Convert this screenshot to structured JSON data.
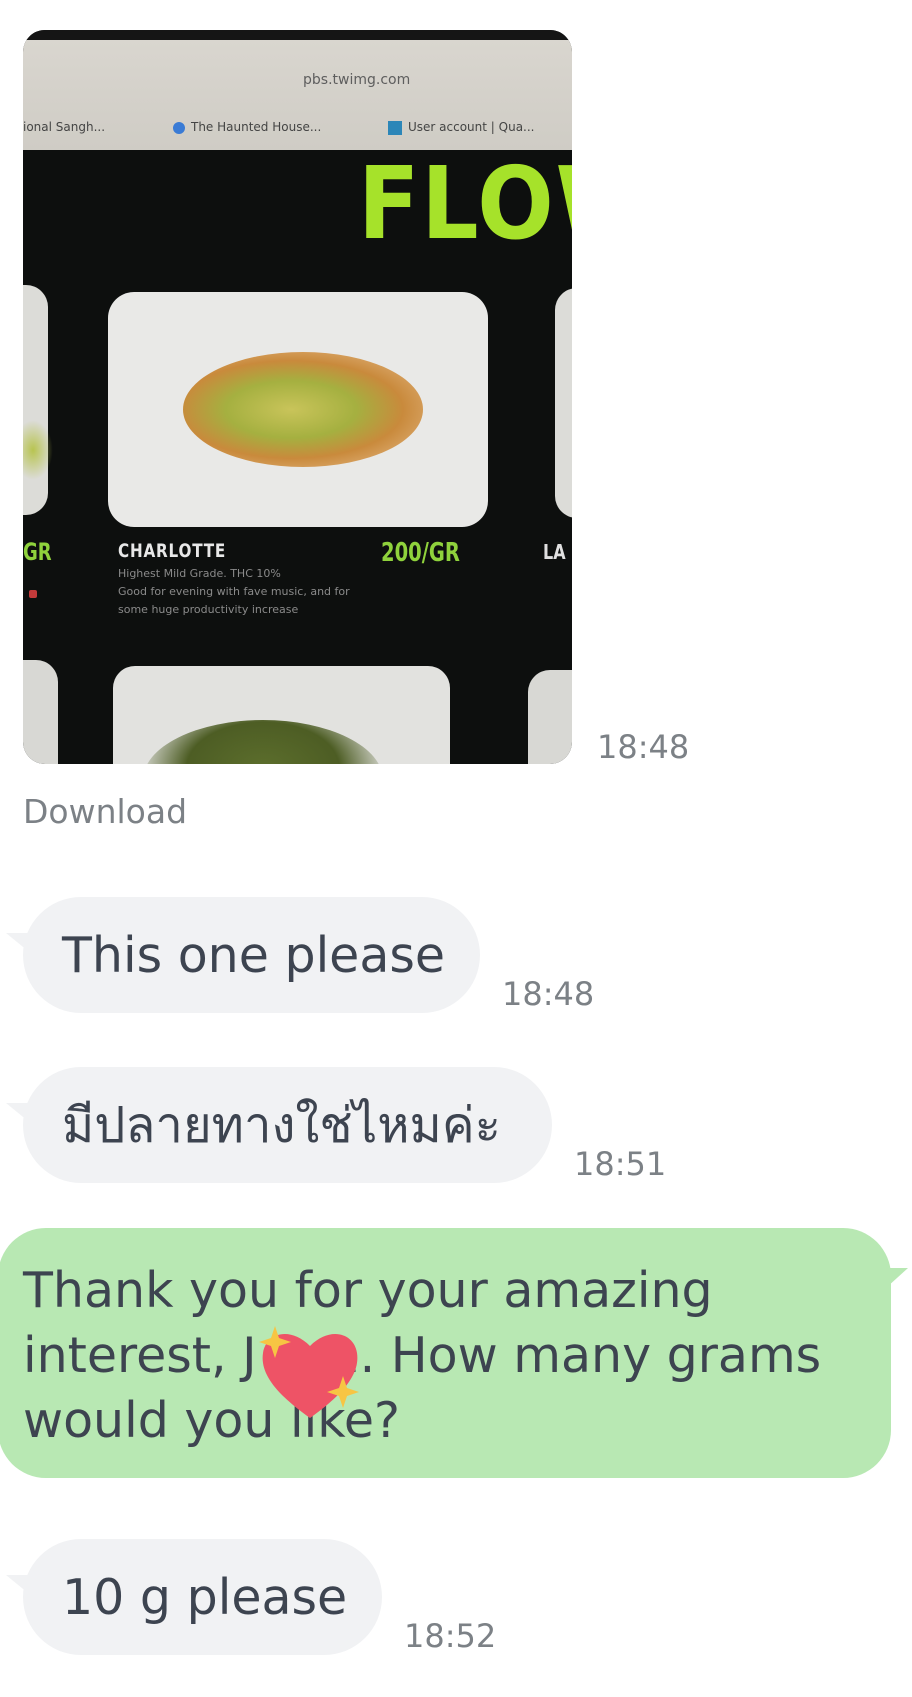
{
  "photo": {
    "url": "pbs.twimg.com",
    "tabs": [
      "ional Sangh...",
      "The Haunted House...",
      "User account | Qua..."
    ],
    "brand": "FLOW",
    "strain_name": "CHARLOTTE",
    "price": "200/GR",
    "desc_line1": "Highest Mild Grade. THC 10%",
    "desc_line2": "Good for evening with fave music, and for",
    "desc_line3": "some huge productivity increase",
    "left_price_fragment": "GR",
    "right_name_fragment": "LA",
    "timestamp": "18:48"
  },
  "download_label": "Download",
  "messages": [
    {
      "text": "This one please",
      "time": "18:48"
    },
    {
      "text": "มีปลายทางใช่ไหมค่ะ",
      "time": "18:51"
    },
    {
      "line1": "Thank you for your amazing",
      "line2": "interest, J",
      "line2b": "n. How many grams",
      "line3": "would you li",
      "line3b": "ke?"
    },
    {
      "text": "10 g please",
      "time": "18:52"
    }
  ],
  "colors": {
    "incoming_bubble": "#f1f2f4",
    "outgoing_bubble": "#b8e8b3",
    "heart": "#ee5366",
    "sparkle": "#f7c543"
  },
  "icons": [
    "heart-sparkle-sticker"
  ]
}
